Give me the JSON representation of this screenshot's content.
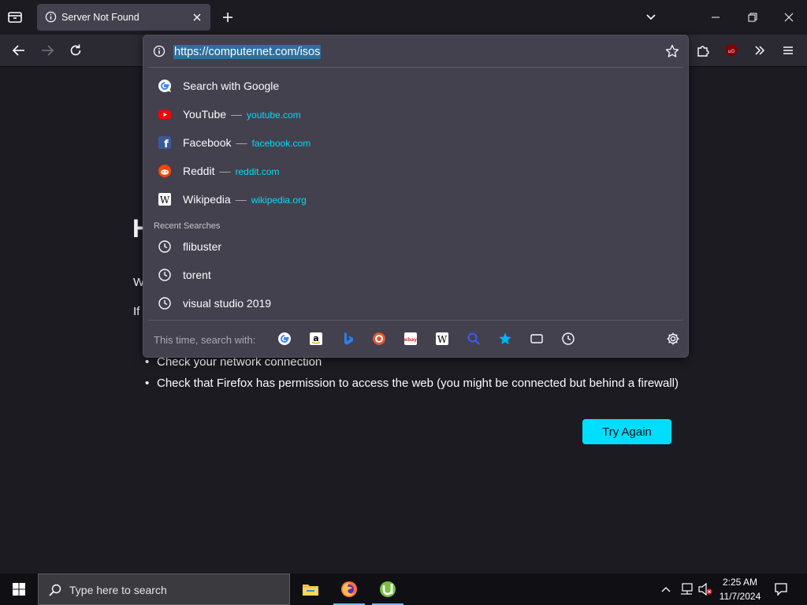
{
  "tab": {
    "title": "Server Not Found"
  },
  "urlbar": {
    "value": "https://computernet.com/isos"
  },
  "suggestions": [
    {
      "title": "Search with Google",
      "url": ""
    },
    {
      "title": "YouTube",
      "url": "youtube.com"
    },
    {
      "title": "Facebook",
      "url": "facebook.com"
    },
    {
      "title": "Reddit",
      "url": "reddit.com"
    },
    {
      "title": "Wikipedia",
      "url": "wikipedia.org"
    }
  ],
  "recent": {
    "header": "Recent Searches",
    "items": [
      "flibuster",
      "torent",
      "visual studio 2019"
    ]
  },
  "oneoff": {
    "label": "This time, search with:"
  },
  "error": {
    "bullets": [
      "Check your network connection",
      "Check that Firefox has permission to access the web (you might be connected but behind a firewall)"
    ],
    "try_again": "Try Again"
  },
  "taskbar": {
    "search_placeholder": "Type here to search",
    "time": "2:25 AM",
    "date": "11/7/2024"
  },
  "colors": {
    "accent": "#00ddff",
    "link": "#00ddff",
    "selection": "#2e6f9e"
  }
}
